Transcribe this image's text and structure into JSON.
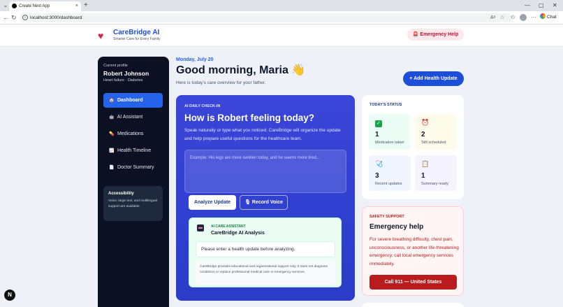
{
  "browser": {
    "tab_title": "Create Next App",
    "tab_close": "×",
    "new_tab": "+",
    "url": "localhost:3000/dashboard",
    "chat_label": "Chat",
    "window_controls": [
      "—",
      "▢",
      "✕"
    ]
  },
  "header": {
    "brand_name": "CareBridge AI",
    "tagline": "Smarter Care for Every Family",
    "emergency_button": "Emergency Help"
  },
  "sidebar": {
    "profile_label": "Current profile",
    "patient_name": "Robert Johnson",
    "conditions": "Heart failure · Diabetes",
    "items": [
      {
        "label": "Dashboard",
        "icon": "house-icon",
        "active": true
      },
      {
        "label": "AI Assistant",
        "icon": "robot-icon",
        "active": false
      },
      {
        "label": "Medications",
        "icon": "pill-icon",
        "active": false
      },
      {
        "label": "Health Timeline",
        "icon": "chart-icon",
        "active": false
      },
      {
        "label": "Doctor Summary",
        "icon": "document-icon",
        "active": false
      }
    ],
    "accessibility": {
      "title": "Accessibility",
      "text": "Voice, large text, and multilingual support are available."
    }
  },
  "main": {
    "date": "Monday, July 20",
    "greeting": "Good morning, Maria 👋",
    "subtext": "Here is today’s care overview for your father.",
    "add_button": "+ Add Health Update"
  },
  "checkin": {
    "eyebrow": "AI DAILY CHECK-IN",
    "title": "How is Robert feeling today?",
    "description": "Speak naturally or type what you noticed. CareBridge will organize the update and help prepare useful questions for the healthcare team.",
    "placeholder": "Example: His legs are more swollen today, and he seems more tired...",
    "analyze_button": "Analyze Update",
    "voice_button": "🎙 Record Voice",
    "analysis": {
      "eyebrow": "AI CARE ASSISTANT",
      "title": "CareBridge AI Analysis",
      "message": "Please enter a health update before analyzing.",
      "disclaimer": "CareBridge provides educational and organizational support only. It does not diagnose conditions or replace professional medical care or emergency services."
    }
  },
  "status": {
    "title": "TODAY'S STATUS",
    "tiles": [
      {
        "value": "1",
        "label": "Medication taken",
        "icon": "check-icon"
      },
      {
        "value": "2",
        "label": "Still scheduled",
        "icon": "alarm-clock-icon"
      },
      {
        "value": "3",
        "label": "Recent updates",
        "icon": "stethoscope-icon"
      },
      {
        "value": "1",
        "label": "Summary ready",
        "icon": "clipboard-icon"
      }
    ]
  },
  "safety": {
    "eyebrow": "SAFETY SUPPORT",
    "title": "Emergency help",
    "text": "For severe breathing difficulty, chest pain, unconsciousness, or another life-threatening emergency, call local emergency services immediately.",
    "call_button": "Call 911 — United States"
  },
  "colors": {
    "brand_blue": "#1d4ed8",
    "sidebar_bg": "#0b1023",
    "emergency_red": "#b91c1c",
    "checkin_bg": "#3b46d8"
  }
}
